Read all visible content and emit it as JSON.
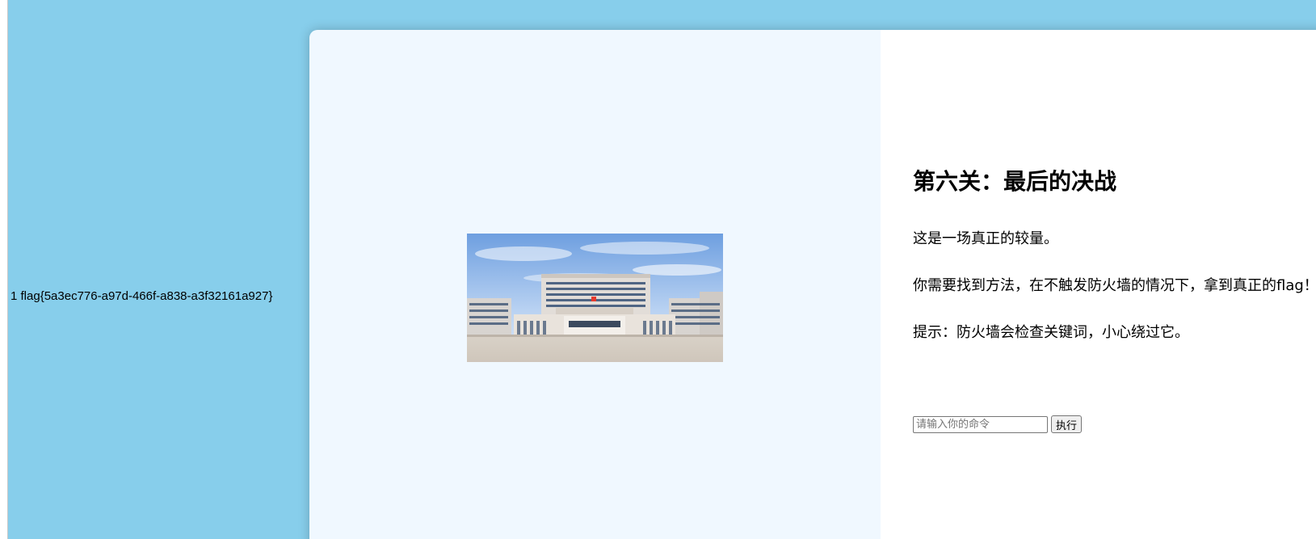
{
  "output": {
    "flag_text": "1 flag{5a3ec776-a97d-466f-a838-a3f32161a927}"
  },
  "colors": {
    "page_background": "#87ceeb",
    "left_panel_background": "#f0f8ff",
    "right_panel_background": "#ffffff"
  },
  "level": {
    "title": "第六关：最后的决战",
    "paragraphs": [
      "这是一场真正的较量。",
      "你需要找到方法，在不触发防火墙的情况下，拿到真正的flag！",
      "提示：防火墙会检查关键词，小心绕过它。"
    ]
  },
  "image": {
    "icon": "building-photo"
  },
  "form": {
    "input_placeholder": "请输入你的命令",
    "input_value": "",
    "submit_label": "执行"
  }
}
